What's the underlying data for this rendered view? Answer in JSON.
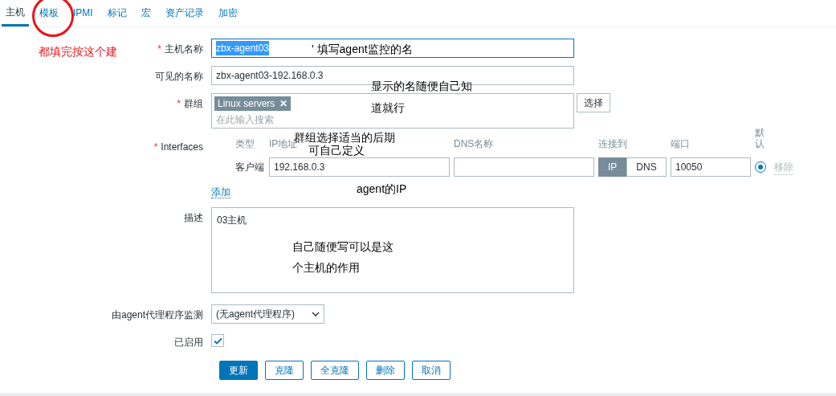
{
  "tabs": [
    {
      "label": "主机",
      "selected": true,
      "circled": false
    },
    {
      "label": "模板",
      "selected": false,
      "circled": true
    },
    {
      "label": "IPMI",
      "selected": false,
      "circled": false
    },
    {
      "label": "标记",
      "selected": false,
      "circled": false
    },
    {
      "label": "宏",
      "selected": false,
      "circled": false
    },
    {
      "label": "资产记录",
      "selected": false,
      "circled": false
    },
    {
      "label": "加密",
      "selected": false,
      "circled": false
    }
  ],
  "host_name": {
    "label": "主机名称",
    "required_mark": "*",
    "value": "zbx-agent03",
    "value_selected": true
  },
  "visible_name": {
    "label": "可见的名称",
    "value": "zbx-agent03-192.168.0.3"
  },
  "groups": {
    "label": "群组",
    "required_mark": "*",
    "tags": [
      {
        "label": "Linux servers",
        "remove": "✕"
      }
    ],
    "placeholder": "在此输入搜索",
    "select_button": "选择"
  },
  "interfaces": {
    "label": "Interfaces",
    "required_mark": "*",
    "headers": [
      "类型",
      "IP地址",
      "DNS名称",
      "连接到",
      "端口",
      "默认"
    ],
    "rows": [
      {
        "type": "客户端",
        "ip": "192.168.0.3",
        "dns": "",
        "connect": [
          {
            "label": "IP",
            "selected": true
          },
          {
            "label": "DNS",
            "selected": false
          }
        ],
        "port": "10050",
        "default": true,
        "remove": "移除"
      }
    ],
    "add_link": "添加"
  },
  "description": {
    "label": "描述",
    "value": "03主机"
  },
  "proxy": {
    "label": "由agent代理程序监测",
    "value": "(无agent代理程序)"
  },
  "enabled": {
    "label": "已启用",
    "checked": true
  },
  "buttons": [
    {
      "label": "更新",
      "primary": true
    },
    {
      "label": "克隆",
      "primary": false
    },
    {
      "label": "全克隆",
      "primary": false
    },
    {
      "label": "删除",
      "primary": false
    },
    {
      "label": "取消",
      "primary": false
    }
  ],
  "button_note": "都填完按这个建",
  "notes": [
    "' 填写agent监控的名",
    "显示的名随便自己知",
    "道就行",
    "群组选择适当的后期",
    "可自己定义",
    "agent的IP",
    "自己随便写可以是这",
    "个主机的作用"
  ]
}
